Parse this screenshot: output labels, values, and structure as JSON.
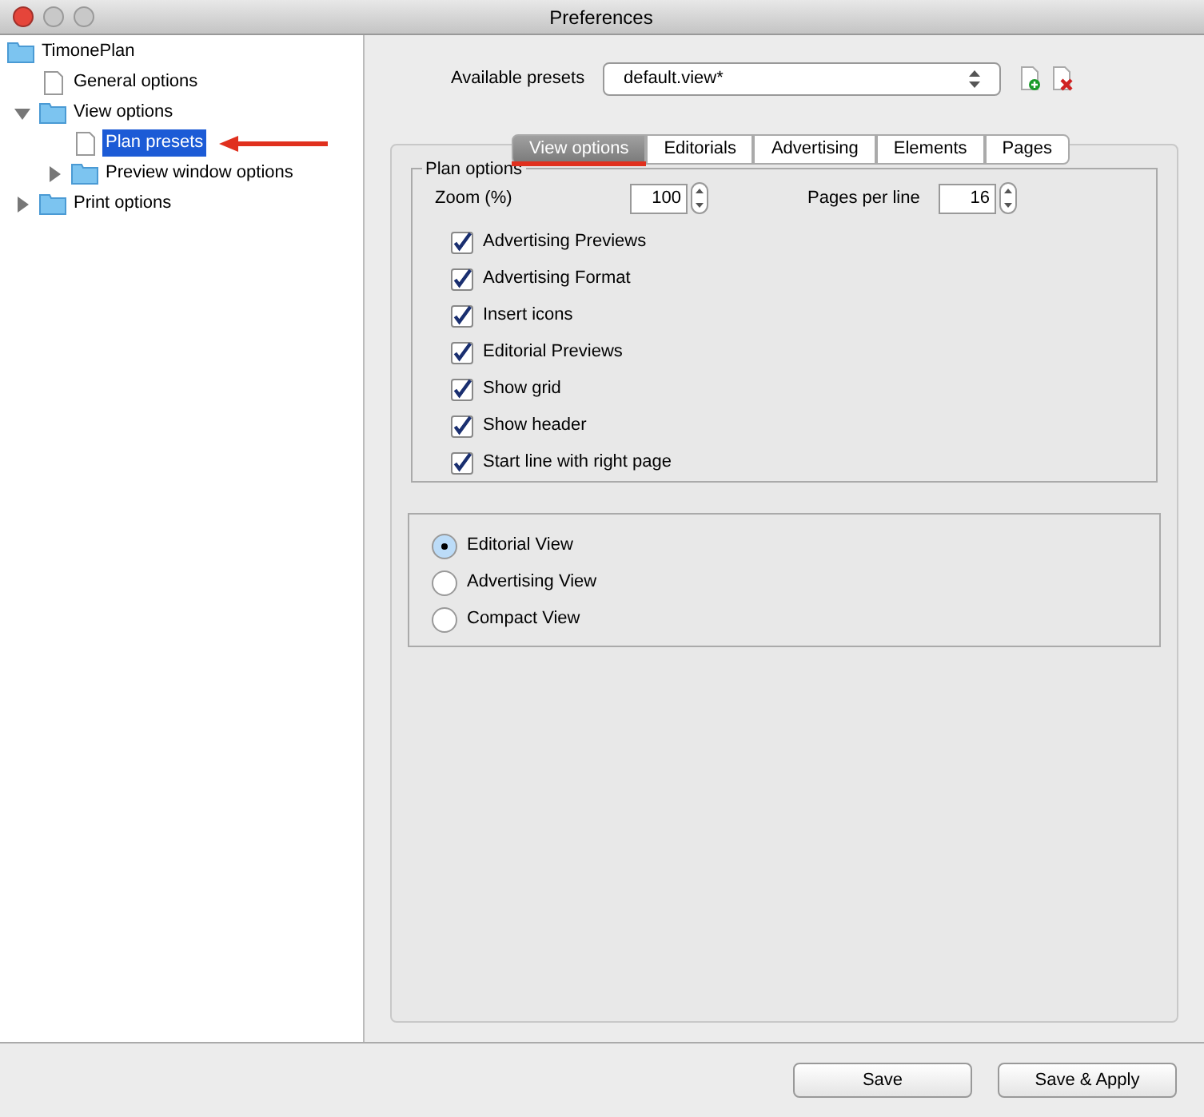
{
  "window": {
    "title": "Preferences"
  },
  "tree": [
    {
      "label": "TimonePlan",
      "kind": "folder",
      "selected": false,
      "children": [
        {
          "label": "General options",
          "kind": "page",
          "selected": false
        },
        {
          "label": "View options",
          "kind": "folder",
          "expanded": true,
          "selected": false,
          "children": [
            {
              "label": "Plan presets",
              "kind": "page",
              "selected": true
            },
            {
              "label": "Preview window options",
              "kind": "folder",
              "expanded": false,
              "selected": false
            }
          ]
        },
        {
          "label": "Print options",
          "kind": "folder",
          "expanded": false,
          "selected": false
        }
      ]
    }
  ],
  "presets": {
    "label": "Available presets",
    "value": "default.view*"
  },
  "tabs": [
    {
      "label": "View options",
      "selected": true
    },
    {
      "label": "Editorials",
      "selected": false
    },
    {
      "label": "Advertising",
      "selected": false
    },
    {
      "label": "Elements",
      "selected": false
    },
    {
      "label": "Pages",
      "selected": false
    }
  ],
  "plan_options": {
    "title": "Plan options",
    "zoom": {
      "label": "Zoom (%)",
      "value": "100"
    },
    "pages_per_line": {
      "label": "Pages per line",
      "value": "16"
    },
    "checkboxes": [
      {
        "label": "Advertising Previews",
        "checked": true
      },
      {
        "label": "Advertising Format",
        "checked": true
      },
      {
        "label": "Insert icons",
        "checked": true
      },
      {
        "label": "Editorial Previews",
        "checked": true
      },
      {
        "label": "Show grid",
        "checked": true
      },
      {
        "label": "Show header",
        "checked": true
      },
      {
        "label": "Start line with right page",
        "checked": true
      }
    ]
  },
  "views": [
    {
      "label": "Editorial View",
      "selected": true
    },
    {
      "label": "Advertising View",
      "selected": false
    },
    {
      "label": "Compact View",
      "selected": false
    }
  ],
  "buttons": [
    "Save",
    "Save & Apply"
  ]
}
